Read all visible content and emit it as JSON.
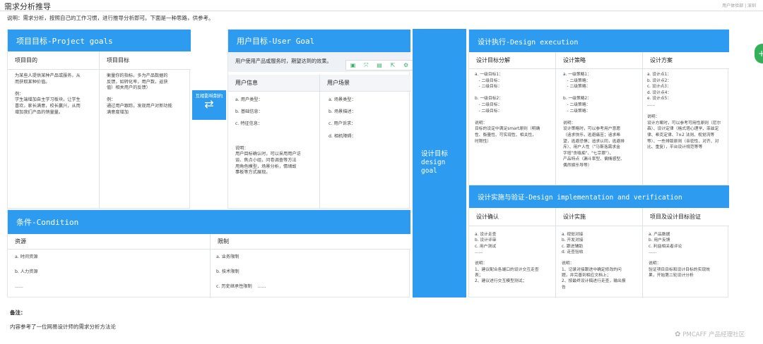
{
  "title": "需求分析推导",
  "top_right": "用户体验部 | 深圳",
  "intro": "说明：需求分析，按照自己的工作习惯，进行推导分析即可。下面是一种思路，供参考。",
  "project": {
    "header": "项目目标-Project goals",
    "col1": "项目目的",
    "col2": "项目目标",
    "c1": "为某些人提供某种产品或服务，从\n而获取某种价值。\n\n例：\n学生端增加自主学习板块，让学生\n喜欢，家长满意，校长赢兴，从而\n增加我们产品的销量量。",
    "c2": "衡量你的指标。多为产品数据的\n反馈，如转化率，用户数，返获\n值）相关用户的反馈）\n\n例：\n通过用户跟踪，发现用户对新功能\n满意度增加"
  },
  "interaction": {
    "label": "互相影响制约",
    "arrows": "⇄"
  },
  "user": {
    "header": "用户目标-User Goal",
    "subtitle": "用户使用产品或服务时，期望达到的效果。",
    "col1": "用户信息",
    "col2": "用户场景",
    "c1": "a. 用户类型：\n\nb. 基础信息：\n\nc. 特征信息：\n\n\n\n说明：\n用户目标确认时，可以采用用户访\n谈、焦点小组，问卷调查等方法\n用角色模型，场景分析，情绪故\n事板等方式展现。",
    "c2": "a. 场景类型：\n\nb. 场景描述：\n\nc. 用户诉求：\n\nd. 相机障碍："
  },
  "design_goal": {
    "label": "设计目标\ndesign\ngoal"
  },
  "execution": {
    "header": "设计执行-Design execution",
    "col1": "设计目标分解",
    "col2": "设计策略",
    "col3": "设计方案",
    "c1": "a. 一级目标1：\n   - 二级目标：\n   - 二级目标：\n\nb. 一级目标2：\n   - 二级目标：\n   - 二级目标：\n\n说明：\n目标的设定中满足smart原则（明确\n性、衡量性、可实现性、相关性，\n时限性）",
    "c2": "a. 一级策略1：\n   - 二级策略：\n   - 二级策略：\n\nb. 一级策略2：\n   - 二级策略：\n   - 二级策略：\n\n说明：\n设计策略时，可以参考用户意愿\n（追求快乐，逃避痛苦；追求希\n望，逃避恐惧；追求认同，逃避排\n斥）、用户人性（\"马斯洛需求金\n字塔\"贪嗔痴\"、\"七宗罪\"）、\n产品特点（漏斗率型、偏情感型、\n偶然娱乐导等）",
    "c3": "a. 设计点1：\nb. 设计点2：\nc. 设计点3：\nd. 设计点4：\ne. 设计点5：\n......\n\n说明：\n设计方案时，可以参考可用性原则（尼尔\n森）、设计定律（格式塔心理学、菲兹定\n律、希克定律、7±2 法则、视觉流等\n等）、一些排版原则（亲密性、对齐、对\n比、重复），平台设计规范等等"
  },
  "implementation": {
    "header": "设计实施与验证-Design implementation and verification",
    "col1": "设计确认",
    "col2": "设计实施",
    "col3": "项目及设计目标验证",
    "c1": "a. 设计走查\nb. 设计评审\nc. 用户测试\n......\n\n说明：\n1、建议配合各端口的设计交互走查\n表；\n2、建议进行交互模型测试；",
    "c2": "a. 视觉对接\nb. 开发对接\nc. 跟进辅助\nd. 走查验收\n\n说明：\n1、记录对接跟进中确定修改的问\n题，并完善到相应文档上；\n2、按最终设计稿进行走查，输出报\n告",
    "c3": "a. 产品数据\nb. 用户反馈\nc. 利益相关者评论\n......\n\n说明：\n验证项目目标和设计目标的实现效\n果，开始第二轮设计分析"
  },
  "condition": {
    "header": "条件-Condition",
    "col1": "资源",
    "col2": "限制",
    "c1": "a. 时间资源\n\nb. 人力资源\n\n......",
    "c2": "a. 业务限制\n\nb. 技术限制\n\nc. 历史继承性限制    ......"
  },
  "note": {
    "label": "备注：",
    "text": "内容参考了一位网易设计师的需求分析方法论"
  },
  "watermark": "PMCAFF 产品经理社区",
  "toolbar": [
    "copy-icon",
    "expand-icon",
    "save-icon",
    "share-icon",
    "settings-icon"
  ],
  "colors": {
    "accent": "#2d9cf0"
  }
}
